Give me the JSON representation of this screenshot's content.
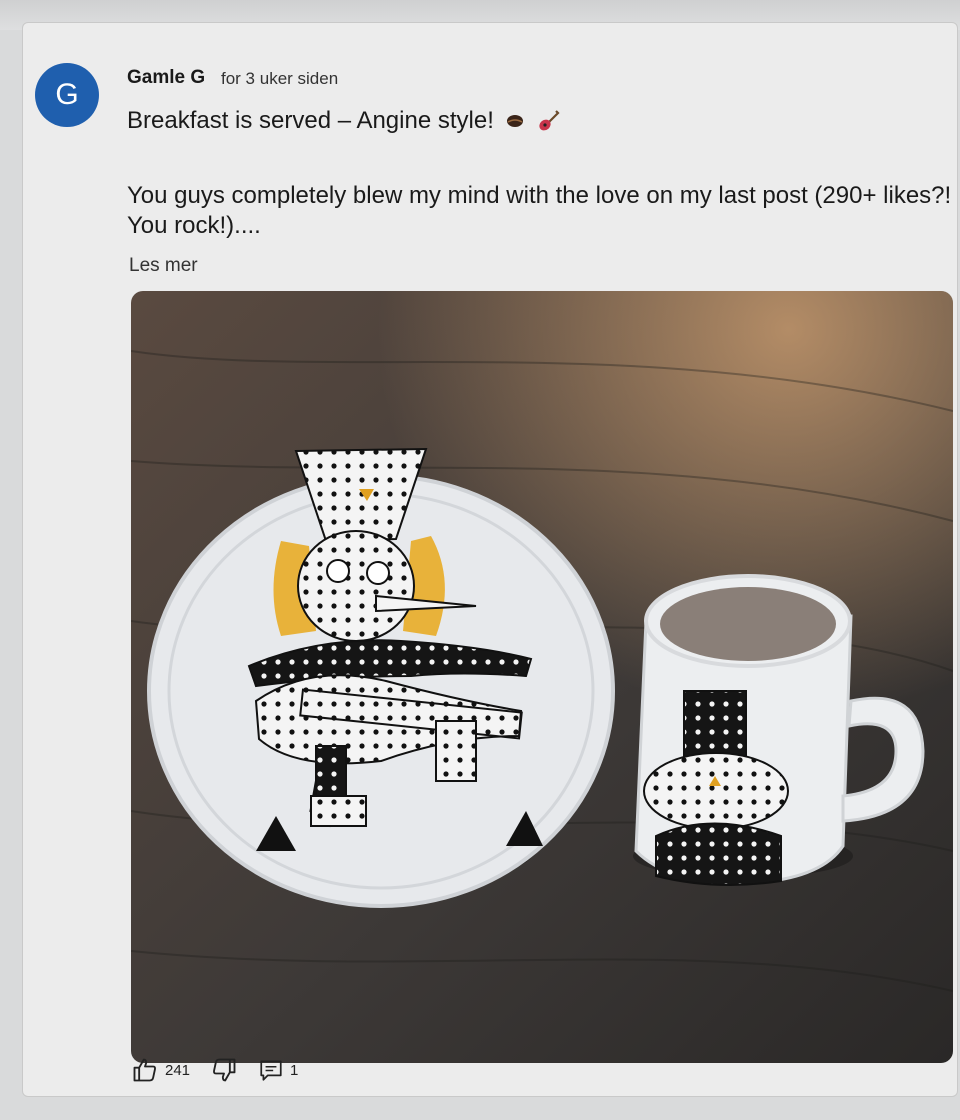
{
  "post": {
    "avatar_letter": "G",
    "author": "Gamle G",
    "timestamp": "for 3 uker siden",
    "title": "Breakfast is served – Angine style!",
    "title_icons": [
      "coffee-bean-icon",
      "guitar-icon"
    ],
    "body": "You guys completely blew my mind with the love on my last post (290+ likes?! You rock!)....",
    "read_more": "Les mer",
    "image_alt": "Hand-painted plate and mug with a guitarist character in a polka-dot top hat",
    "colors": {
      "avatar": "#1f5fae",
      "card": "#ececec"
    }
  },
  "actions": {
    "like_count": "241",
    "comment_count": "1",
    "icons": [
      "thumbs-up-icon",
      "thumbs-down-icon",
      "comment-icon"
    ]
  }
}
